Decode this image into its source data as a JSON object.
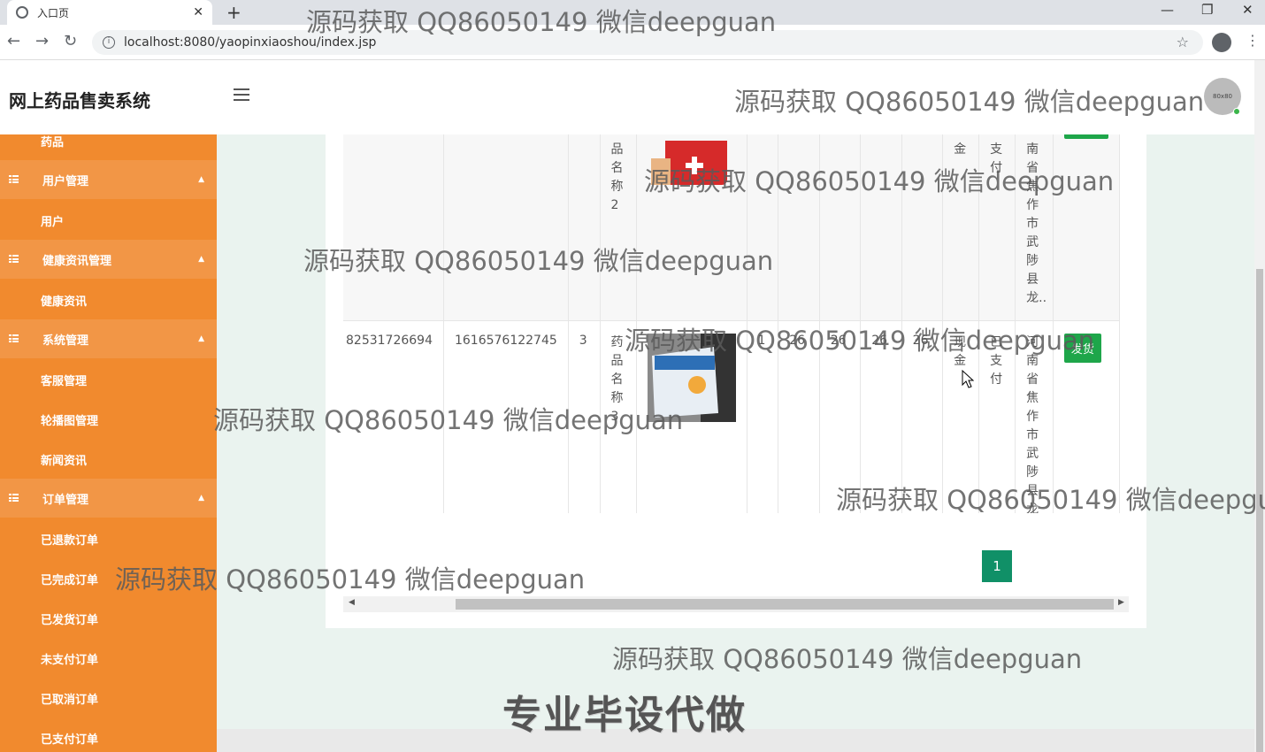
{
  "browser": {
    "tab_title": "入口页",
    "url": "localhost:8080/yaopinxiaoshou/index.jsp"
  },
  "header": {
    "app_title": "网上药品售卖系统",
    "avatar_text": "80x80"
  },
  "sidebar": {
    "partial_item": "药品",
    "groups": [
      {
        "label": "用户管理",
        "items": [
          "用户"
        ]
      },
      {
        "label": "健康资讯管理",
        "items": [
          "健康资讯"
        ]
      },
      {
        "label": "系统管理",
        "items": [
          "客服管理",
          "轮播图管理",
          "新闻资讯"
        ]
      },
      {
        "label": "订单管理",
        "items": [
          "已退款订单",
          "已完成订单",
          "已发货订单",
          "未支付订单",
          "已取消订单",
          "已支付订单"
        ]
      }
    ]
  },
  "table": {
    "rows": [
      {
        "order_no": "",
        "user_id": "",
        "product_id": "",
        "product_name": "品名称2",
        "qty": "",
        "price": "",
        "price2": "",
        "total": "",
        "total2": "",
        "pay_type": "金",
        "status": "支付",
        "address": "南省焦作市武陟县龙..",
        "action": ""
      },
      {
        "order_no": "82531726694",
        "user_id": "1616576122745",
        "product_id": "3",
        "product_name": "药品名称3",
        "qty": "1",
        "price": "26",
        "price2": "26",
        "total": "26",
        "total2": "26",
        "pay_type": "现金",
        "status": "已支付",
        "address": "河南省焦作市武陟县龙",
        "action": "发货"
      }
    ]
  },
  "pagination": {
    "current": "1"
  },
  "watermarks": [
    "源码获取 QQ86050149 微信deepguan",
    "源码获取 QQ86050149 微信deepguan",
    "源码获取 QQ86050149 微信deepguan",
    "源码获取 QQ86050149 微信deepguan",
    "源码获取 QQ86050149 微信deepguan",
    "源码获取 QQ86050149 微信deepguan",
    "源码获取 QQ86050149 微信deepgu",
    "源码获取 QQ86050149 微信deepguan",
    "源码获取 QQ86050149 微信deepguan"
  ],
  "promo": "专业毕设代做",
  "colors": {
    "sidebar": "#f18a2e",
    "accent": "#1ea64a",
    "page": "#109067"
  }
}
